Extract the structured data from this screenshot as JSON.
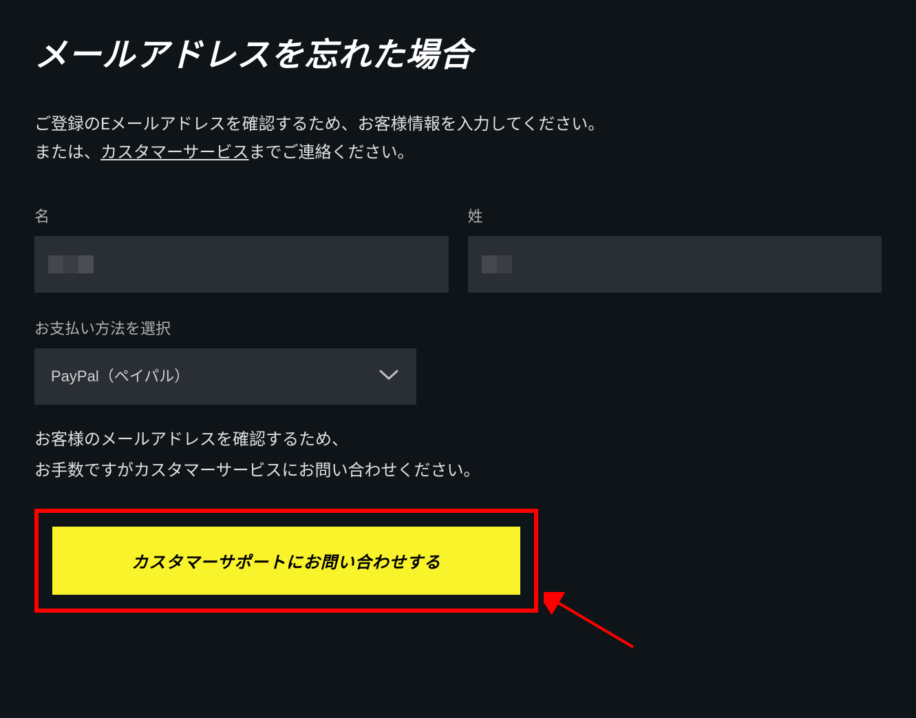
{
  "page": {
    "title": "メールアドレスを忘れた場合",
    "description_line1": "ご登録のEメールアドレスを確認するため、お客様情報を入力してください。",
    "description_line2_prefix": "または、",
    "description_link": "カスタマーサービス",
    "description_line2_suffix": "までご連絡ください。"
  },
  "form": {
    "first_name_label": "名",
    "last_name_label": "姓",
    "payment_method_label": "お支払い方法を選択",
    "payment_method_selected": "PayPal（ペイパル）"
  },
  "helper": {
    "line1": "お客様のメールアドレスを確認するため、",
    "line2": "お手数ですがカスタマーサービスにお問い合わせください。"
  },
  "cta": {
    "label": "カスタマーサポートにお問い合わせする"
  }
}
